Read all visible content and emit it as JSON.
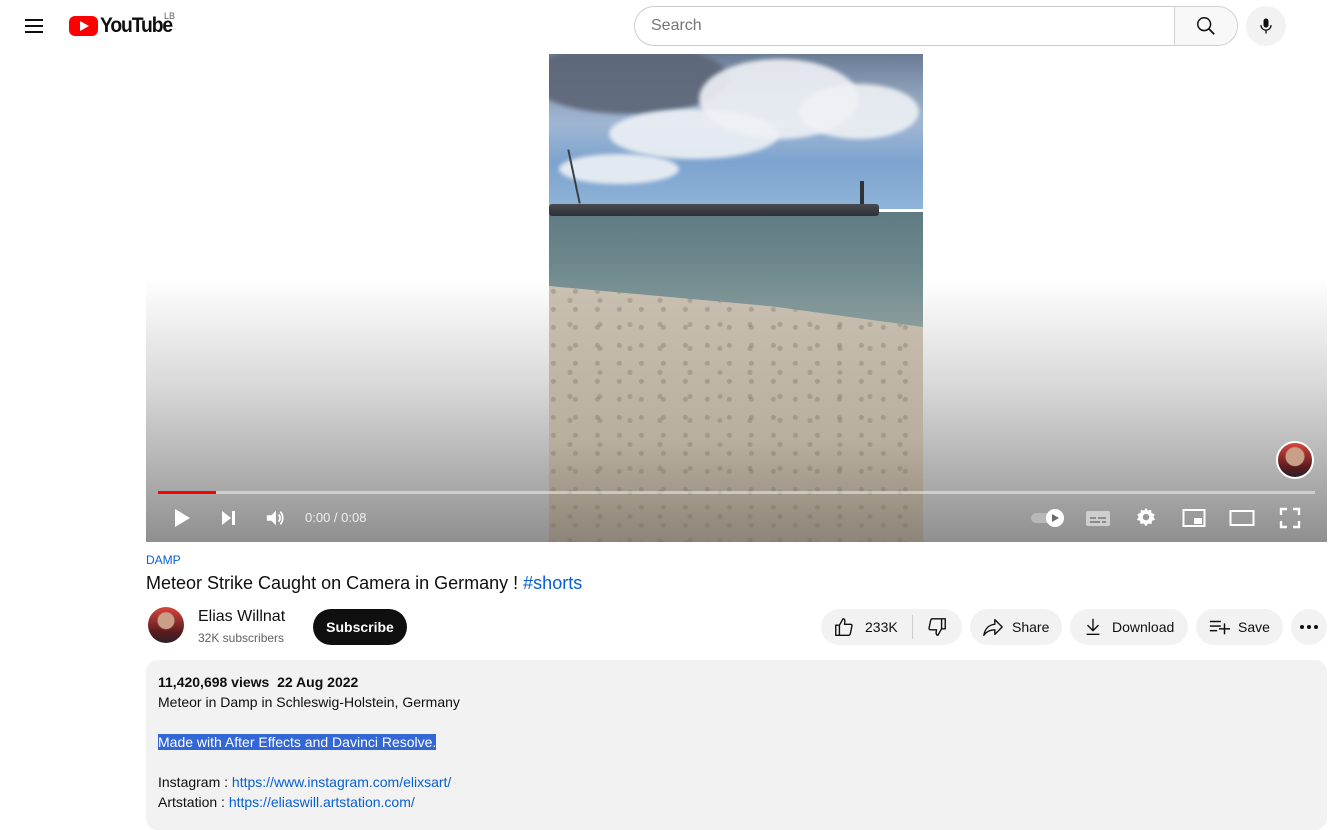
{
  "masthead": {
    "logo_text": "YouTube",
    "country_code": "LB",
    "search_placeholder": "Search"
  },
  "player": {
    "time_display": "0:00 / 0:08",
    "progress_fraction": 0.05
  },
  "video": {
    "tag": "DAMP",
    "title": "Meteor Strike Caught on Camera in Germany !",
    "hashtag": "#shorts"
  },
  "channel": {
    "name": "Elias Willnat",
    "subscribers": "32K subscribers",
    "subscribe_label": "Subscribe"
  },
  "actions": {
    "like_count": "233K",
    "share_label": "Share",
    "download_label": "Download",
    "save_label": "Save"
  },
  "description": {
    "views": "11,420,698 views",
    "date": "22 Aug 2022",
    "line1": "Meteor in Damp in Schleswig-Holstein, Germany",
    "line2": "Made with After Effects and Davinci Resolve.",
    "instagram_label": "Instagram : ",
    "instagram_url": "https://www.instagram.com/elixsart/",
    "artstation_label": "Artstation : ",
    "artstation_url": "https://eliaswill.artstation.com/"
  },
  "colors": {
    "brand_red": "#ff0000",
    "link_blue": "#065fd4",
    "selection_blue": "#3367d6"
  }
}
